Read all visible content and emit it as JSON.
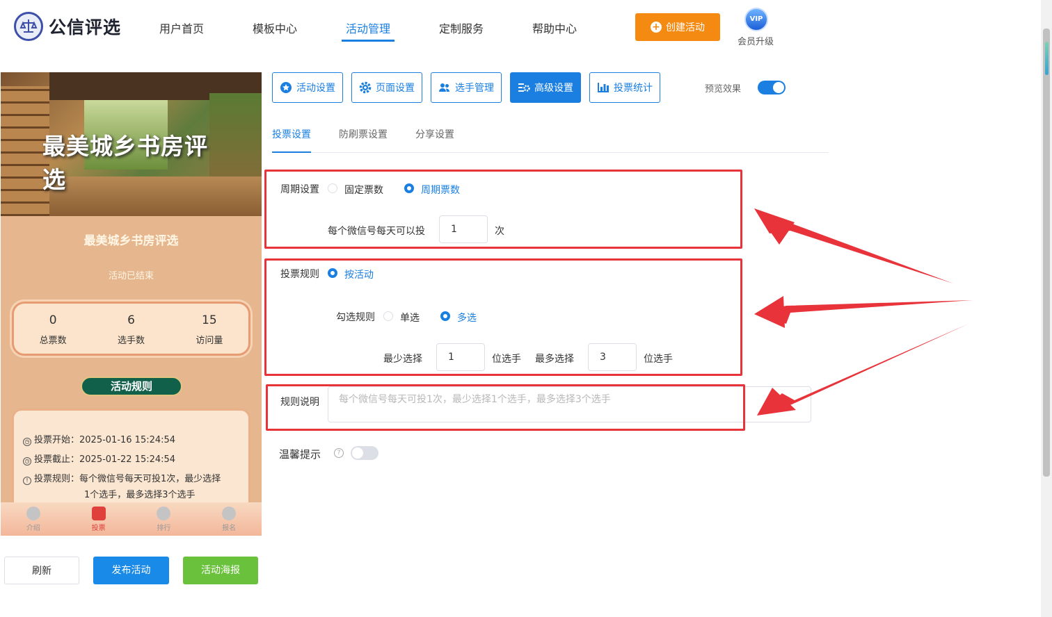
{
  "header": {
    "brand": "公信评选",
    "nav": [
      "用户首页",
      "模板中心",
      "活动管理",
      "定制服务",
      "帮助中心"
    ],
    "active_nav": "活动管理",
    "create_button": "创建活动",
    "vip_badge": "VIP",
    "vip_label": "会员升级"
  },
  "preview": {
    "banner_title": "最美城乡书房评选",
    "title": "最美城乡书房评选",
    "status": "活动已结束",
    "stats": [
      {
        "value": "0",
        "label": "总票数"
      },
      {
        "value": "6",
        "label": "选手数"
      },
      {
        "value": "15",
        "label": "访问量"
      }
    ],
    "rules_button": "活动规则",
    "rules": {
      "start": "投票开始：2025-01-16 15:24:54",
      "end": "投票截止：2025-01-22 15:24:54",
      "rule_line1": "投票规则：每个微信号每天可投1次，最少选择",
      "rule_line2": "1个选手，最多选择3个选手"
    },
    "tabbar": [
      "介绍",
      "投票",
      "排行",
      "报名"
    ],
    "active_tab": "投票"
  },
  "actions": {
    "refresh": "刷新",
    "publish": "发布活动",
    "poster": "活动海报"
  },
  "toolbar": {
    "buttons": [
      "活动设置",
      "页面设置",
      "选手管理",
      "高级设置",
      "投票统计"
    ],
    "active": "高级设置",
    "preview_label": "预览效果",
    "preview_on": true
  },
  "subtabs": {
    "items": [
      "投票设置",
      "防刷票设置",
      "分享设置"
    ],
    "active": "投票设置"
  },
  "form": {
    "period_label": "周期设置",
    "period_options": [
      "固定票数",
      "周期票数"
    ],
    "period_selected": "周期票数",
    "per_day_label": "每个微信号每天可以投",
    "per_day_value": "1",
    "per_day_unit": "次",
    "vote_rule_label": "投票规则",
    "vote_rule_option": "按活动",
    "check_rule_label": "勾选规则",
    "check_options": [
      "单选",
      "多选"
    ],
    "check_selected": "多选",
    "min_label": "最少选择",
    "min_value": "1",
    "min_unit": "位选手",
    "max_label": "最多选择",
    "max_value": "3",
    "max_unit": "位选手",
    "desc_label": "规则说明",
    "desc_placeholder": "每个微信号每天可投1次，最少选择1个选手，最多选择3个选手",
    "tip_label": "温馨提示",
    "tip_on": false
  },
  "colors": {
    "primary": "#1a7fe0",
    "orange": "#f58a12",
    "green": "#6ac13b",
    "highlight_red": "#e8333a"
  }
}
